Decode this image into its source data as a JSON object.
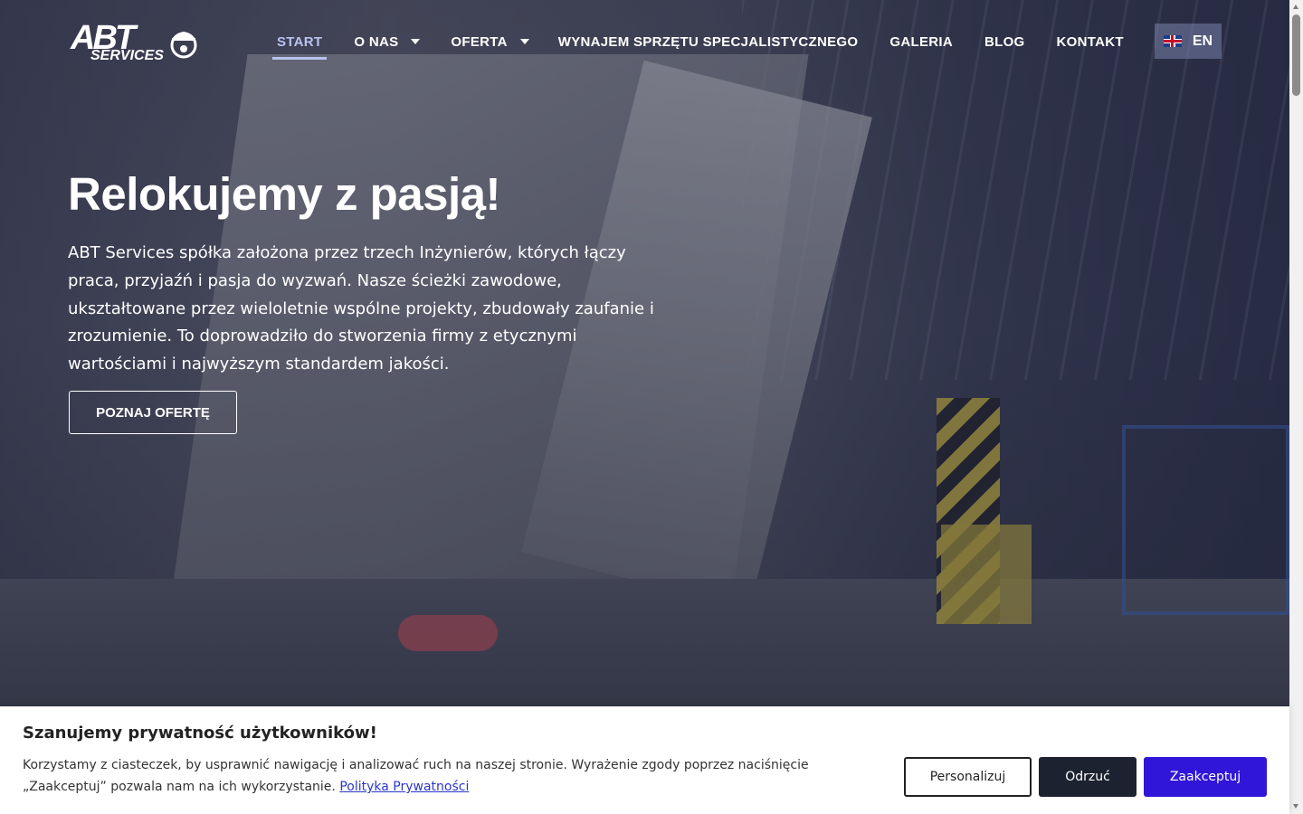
{
  "logo": {
    "alt_text": "ABT SERVICES",
    "mark": "ABT",
    "sub": "SERVICES"
  },
  "nav": {
    "items": [
      {
        "label": "START",
        "active": true,
        "has_dropdown": false
      },
      {
        "label": "O NAS",
        "active": false,
        "has_dropdown": true
      },
      {
        "label": "OFERTA",
        "active": false,
        "has_dropdown": true
      },
      {
        "label": "WYNAJEM SPRZĘTU SPECJALISTYCZNEGO",
        "active": false,
        "has_dropdown": false
      },
      {
        "label": "GALERIA",
        "active": false,
        "has_dropdown": false
      },
      {
        "label": "BLOG",
        "active": false,
        "has_dropdown": false
      },
      {
        "label": "KONTAKT",
        "active": false,
        "has_dropdown": false
      }
    ],
    "language": {
      "label": "EN",
      "flag_icon": "uk-flag-icon"
    }
  },
  "hero": {
    "title": "Relokujemy z pasją!",
    "text": "ABT Services spółka założona przez trzech Inżynierów, których łączy praca, przyjaźń i pasja do wyzwań. Nasze ścieżki zawodowe, ukształtowane przez wieloletnie wspólne projekty, zbudowały zaufanie i zrozumienie. To doprowadziło do stworzenia firmy z etycznymi wartościami i najwyższym standardem jakości.",
    "cta_label": "POZNAJ OFERTĘ"
  },
  "cookie": {
    "title": "Szanujemy prywatność użytkowników!",
    "text_line1": "Korzystamy z ciasteczek, by usprawnić nawigację i analizować ruch na naszej stronie. Wyrażenie zgody poprzez naciśnięcie",
    "text_line2": "„Zaakceptuj” pozwala nam na ich wykorzystanie.",
    "link_label": "Polityka Prywatności",
    "buttons": {
      "personalize": "Personalizuj",
      "reject": "Odrzuć",
      "accept": "Zaakceptuj"
    }
  },
  "colors": {
    "accent": "#2f16d8",
    "nav_active": "#b8c3ee",
    "reject_bg": "#1d2230",
    "lang_bg": "#7882aa"
  }
}
